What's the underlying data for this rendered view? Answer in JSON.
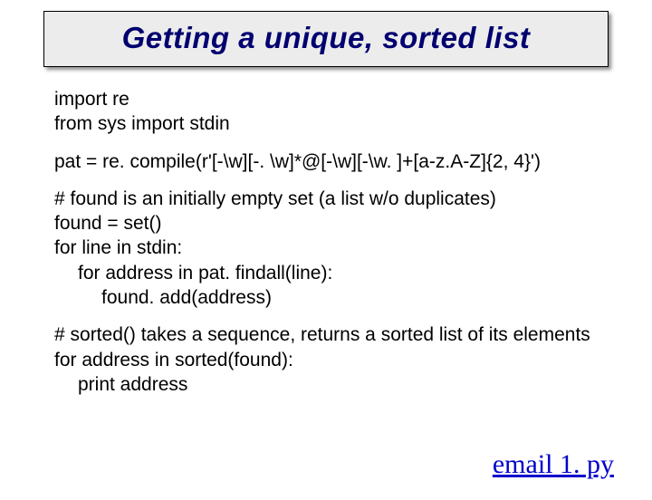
{
  "title": "Getting a unique, sorted list",
  "block1": {
    "l1": "import re",
    "l2": "from sys import stdin"
  },
  "block2": {
    "l1": "pat = re. compile(r'[-\\w][-. \\w]*@[-\\w][-\\w. ]+[a-z.A-Z]{2, 4}')"
  },
  "block3": {
    "l1": "# found is an initially empty set (a list w/o duplicates)",
    "l2": "found = set()",
    "l3": "for line in stdin:",
    "l4": "for address in pat. findall(line):",
    "l5": "found. add(address)"
  },
  "block4": {
    "l1": "# sorted() takes a sequence, returns a sorted list of its elements",
    "l2": "for address in sorted(found):",
    "l3": "print address"
  },
  "filename": "email 1. py"
}
